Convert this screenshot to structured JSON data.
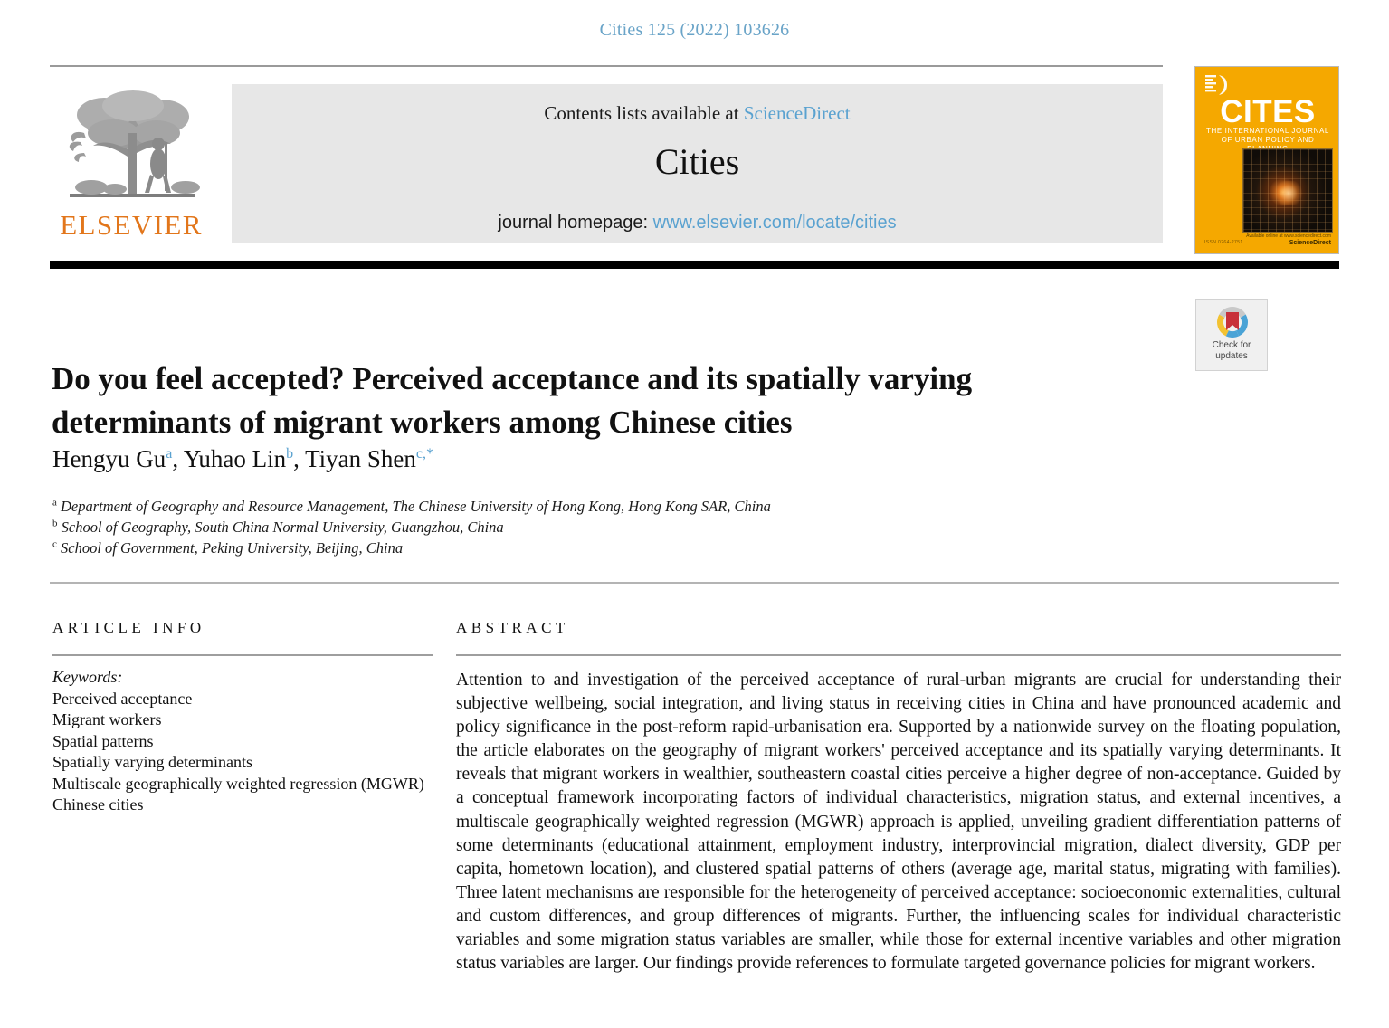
{
  "running_head": "Cities 125 (2022) 103626",
  "masthead": {
    "contents_prefix": "Contents lists available at ",
    "sciencedirect_link": "ScienceDirect",
    "journal_name": "Cities",
    "homepage_prefix": "journal homepage: ",
    "homepage_link": "www.elsevier.com/locate/cities",
    "publisher_wordmark": "ELSEVIER",
    "publisher_logo_icon": "elsevier-tree-icon"
  },
  "cover": {
    "title": "CITES",
    "subtitle": "THE INTERNATIONAL JOURNAL OF URBAN POLICY AND PLANNING",
    "footer_left": "ISSN 0264-2751",
    "footer_right_note": "Available online at www.sciencedirect.com",
    "footer_brand": "ScienceDirect",
    "elsevier_mark_icon": "elsevier-tree-mark-icon",
    "photo_icon": "city-night-lights-image",
    "background_color": "#f5a800"
  },
  "crossmark": {
    "line1": "Check for",
    "line2": "updates",
    "icon": "crossmark-badge-icon",
    "colors": {
      "bookmark": "#c8313a",
      "ring_blue": "#4aa3d6",
      "ring_yellow": "#f2c232",
      "ring_grey": "#c9c9c9"
    }
  },
  "article": {
    "title": "Do you feel accepted? Perceived acceptance and its spatially varying determinants of migrant workers among Chinese cities",
    "authors": [
      {
        "name": "Hengyu Gu",
        "marks": "a"
      },
      {
        "name": "Yuhao Lin",
        "marks": "b"
      },
      {
        "name": "Tiyan Shen",
        "marks": "c,*"
      }
    ],
    "affiliations": [
      {
        "mark": "a",
        "text": "Department of Geography and Resource Management, The Chinese University of Hong Kong, Hong Kong SAR, China"
      },
      {
        "mark": "b",
        "text": "School of Geography, South China Normal University, Guangzhou, China"
      },
      {
        "mark": "c",
        "text": "School of Government, Peking University, Beijing, China"
      }
    ]
  },
  "article_info": {
    "heading": "ARTICLE INFO",
    "keywords_label": "Keywords:",
    "keywords": [
      "Perceived acceptance",
      "Migrant workers",
      "Spatial patterns",
      "Spatially varying determinants",
      "Multiscale geographically weighted regression (MGWR)",
      "Chinese cities"
    ]
  },
  "abstract": {
    "heading": "ABSTRACT",
    "text": "Attention to and investigation of the perceived acceptance of rural-urban migrants are crucial for understanding their subjective wellbeing, social integration, and living status in receiving cities in China and have pronounced academic and policy significance in the post-reform rapid-urbanisation era. Supported by a nationwide survey on the floating population, the article elaborates on the geography of migrant workers' perceived acceptance and its spatially varying determinants. It reveals that migrant workers in wealthier, southeastern coastal cities perceive a higher degree of non-acceptance. Guided by a conceptual framework incorporating factors of individual characteristics, migration status, and external incentives, a multiscale geographically weighted regression (MGWR) approach is applied, unveiling gradient differentiation patterns of some determinants (educational attainment, employment industry, interprovincial migration, dialect diversity, GDP per capita, hometown location), and clustered spatial patterns of others (average age, marital status, migrating with families). Three latent mechanisms are responsible for the heterogeneity of perceived acceptance: socioeconomic externalities, cultural and custom differences, and group differences of migrants. Further, the influencing scales for individual characteristic variables and some migration status variables are smaller, while those for external incentive variables and other migration status variables are larger. Our findings provide references to formulate targeted governance policies for migrant workers."
  }
}
